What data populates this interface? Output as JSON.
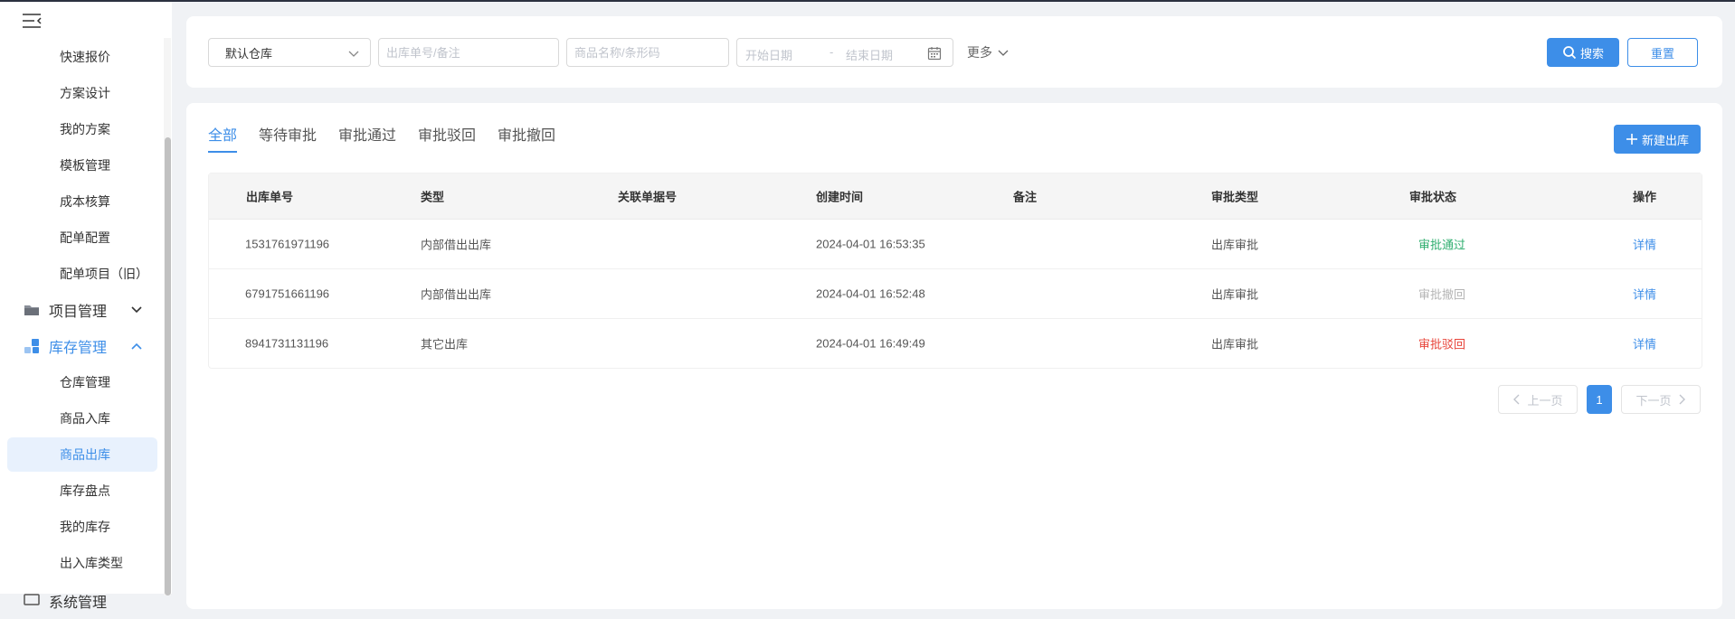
{
  "sidebar": {
    "items_top": [
      {
        "label": "快速报价"
      },
      {
        "label": "方案设计"
      },
      {
        "label": "我的方案"
      },
      {
        "label": "模板管理"
      },
      {
        "label": "成本核算"
      },
      {
        "label": "配单配置"
      },
      {
        "label": "配单项目（旧）"
      }
    ],
    "group_project": {
      "label": "项目管理"
    },
    "group_inventory": {
      "label": "库存管理"
    },
    "items_inventory": [
      {
        "label": "仓库管理"
      },
      {
        "label": "商品入库"
      },
      {
        "label": "商品出库"
      },
      {
        "label": "库存盘点"
      },
      {
        "label": "我的库存"
      },
      {
        "label": "出入库类型"
      }
    ],
    "group_system": {
      "label": "系统管理"
    }
  },
  "filters": {
    "warehouse": "默认仓库",
    "order_placeholder": "出库单号/备注",
    "product_placeholder": "商品名称/条形码",
    "start_date_placeholder": "开始日期",
    "date_separator": "-",
    "end_date_placeholder": "结束日期",
    "more_label": "更多",
    "search_label": "搜索",
    "reset_label": "重置"
  },
  "tabs": [
    {
      "label": "全部"
    },
    {
      "label": "等待审批"
    },
    {
      "label": "审批通过"
    },
    {
      "label": "审批驳回"
    },
    {
      "label": "审批撤回"
    }
  ],
  "new_button_label": "新建出库",
  "table": {
    "columns": [
      "出库单号",
      "类型",
      "关联单据号",
      "创建时间",
      "备注",
      "审批类型",
      "审批状态",
      "操作"
    ],
    "rows": [
      {
        "order_no": "1531761971196",
        "type": "内部借出出库",
        "ref_no": "",
        "created": "2024-04-01 16:53:35",
        "remark": "",
        "approval_type": "出库审批",
        "status": "审批通过",
        "action": "详情"
      },
      {
        "order_no": "6791751661196",
        "type": "内部借出出库",
        "ref_no": "",
        "created": "2024-04-01 16:52:48",
        "remark": "",
        "approval_type": "出库审批",
        "status": "审批撤回",
        "action": "详情"
      },
      {
        "order_no": "8941731131196",
        "type": "其它出库",
        "ref_no": "",
        "created": "2024-04-01 16:49:49",
        "remark": "",
        "approval_type": "出库审批",
        "status": "审批驳回",
        "action": "详情"
      }
    ]
  },
  "pagination": {
    "prev_label": "上一页",
    "current_page": "1",
    "next_label": "下一页"
  },
  "colors": {
    "primary": "#3d8ee8",
    "status_pass": "#2fae6f",
    "status_revoked": "#b5b5b5",
    "status_reject": "#e8443a"
  }
}
